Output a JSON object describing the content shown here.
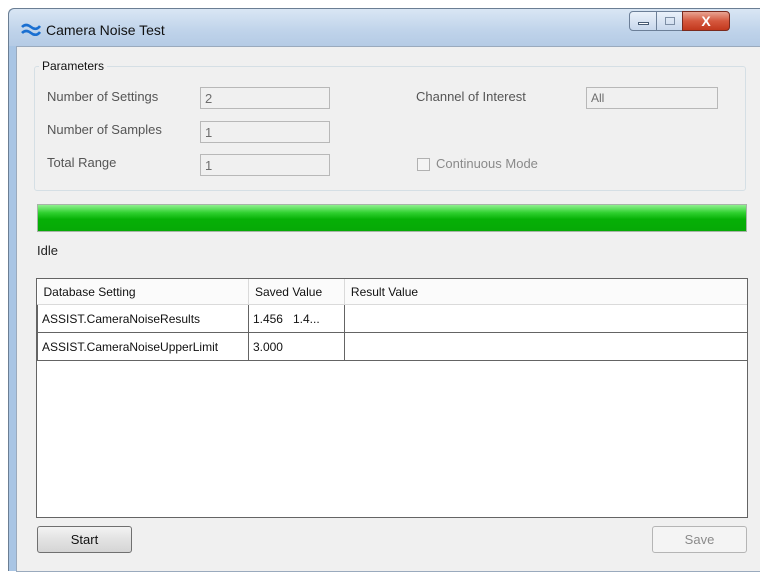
{
  "window": {
    "title": "Camera Noise Test",
    "icon": "app-wave-icon",
    "close_glyph": "X"
  },
  "parameters": {
    "legend": "Parameters",
    "number_of_settings": {
      "label": "Number of Settings",
      "value": "2"
    },
    "number_of_samples": {
      "label": "Number of Samples",
      "value": "1"
    },
    "total_range": {
      "label": "Total Range",
      "value": "1"
    },
    "channel_of_interest": {
      "label": "Channel of Interest",
      "value": "All"
    },
    "continuous_mode": {
      "label": "Continuous Mode",
      "checked": false
    }
  },
  "progress": {
    "value_percent": 100,
    "color": "#06b006"
  },
  "status": "Idle",
  "table": {
    "columns": [
      "Database Setting",
      "Saved Value",
      "Result Value"
    ],
    "rows": [
      [
        "ASSIST.CameraNoiseResults",
        "1.456   1.4...",
        ""
      ],
      [
        "ASSIST.CameraNoiseUpperLimit",
        "3.000",
        ""
      ]
    ]
  },
  "buttons": {
    "start": "Start",
    "save": "Save"
  }
}
